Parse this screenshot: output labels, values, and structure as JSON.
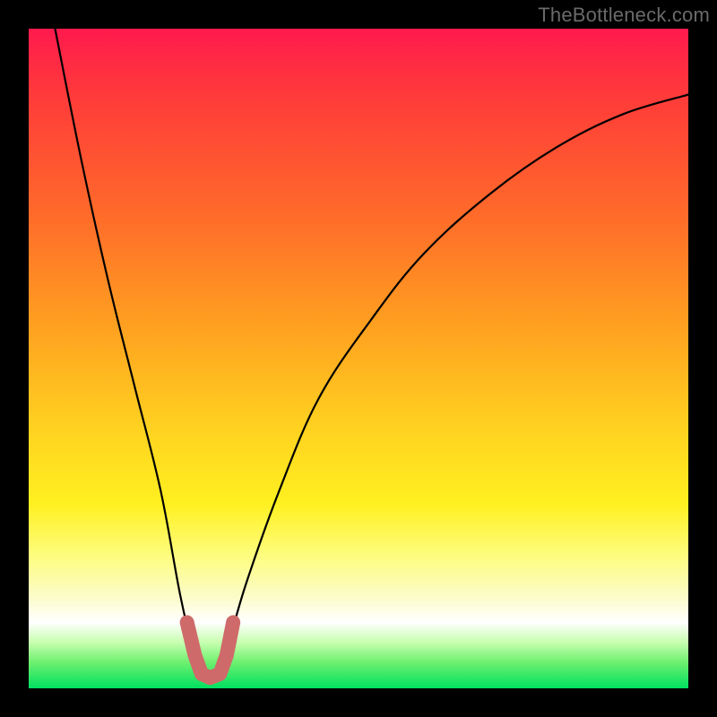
{
  "watermark": "TheBottleneck.com",
  "chart_data": {
    "type": "line",
    "title": "",
    "xlabel": "",
    "ylabel": "",
    "xlim": [
      0,
      100
    ],
    "ylim": [
      0,
      100
    ],
    "series": [
      {
        "name": "bottleneck-curve",
        "color": "#000000",
        "x": [
          4,
          8,
          12,
          16,
          20,
          23,
          25,
          27,
          28,
          30,
          33,
          38,
          44,
          52,
          60,
          70,
          80,
          90,
          100
        ],
        "values": [
          100,
          80,
          62,
          46,
          30,
          14,
          6,
          2,
          2,
          6,
          16,
          30,
          44,
          56,
          66,
          75,
          82,
          87,
          90
        ]
      }
    ],
    "marker": {
      "name": "trough-marker",
      "color": "#cf6a6a",
      "x": [
        24.0,
        25.2,
        26.2,
        27.5,
        29.0,
        30.0,
        31.0
      ],
      "values": [
        10.0,
        5.0,
        2.2,
        1.6,
        2.2,
        5.0,
        10.0
      ]
    }
  }
}
